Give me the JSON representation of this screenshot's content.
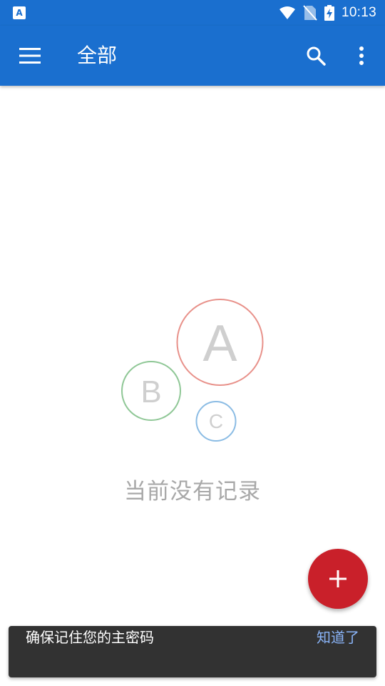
{
  "status_bar": {
    "time": "10:13",
    "app_icon_letter": "A",
    "icons": [
      "wifi-icon",
      "no-sim-icon",
      "battery-charging-icon"
    ]
  },
  "app_bar": {
    "title": "全部",
    "left_icon": "menu-icon",
    "right_icons": [
      "search-icon",
      "more-vert-icon"
    ],
    "background_color": "#1a6fcf"
  },
  "empty_state": {
    "message": "当前没有记录",
    "circles": [
      {
        "letter": "A",
        "color": "#e8918a"
      },
      {
        "letter": "B",
        "color": "#8fc796"
      },
      {
        "letter": "C",
        "color": "#8bbce4"
      }
    ]
  },
  "fab": {
    "icon": "plus-icon",
    "color": "#c9202a"
  },
  "snackbar": {
    "message": "确保记住您的主密码",
    "action": "知道了"
  }
}
